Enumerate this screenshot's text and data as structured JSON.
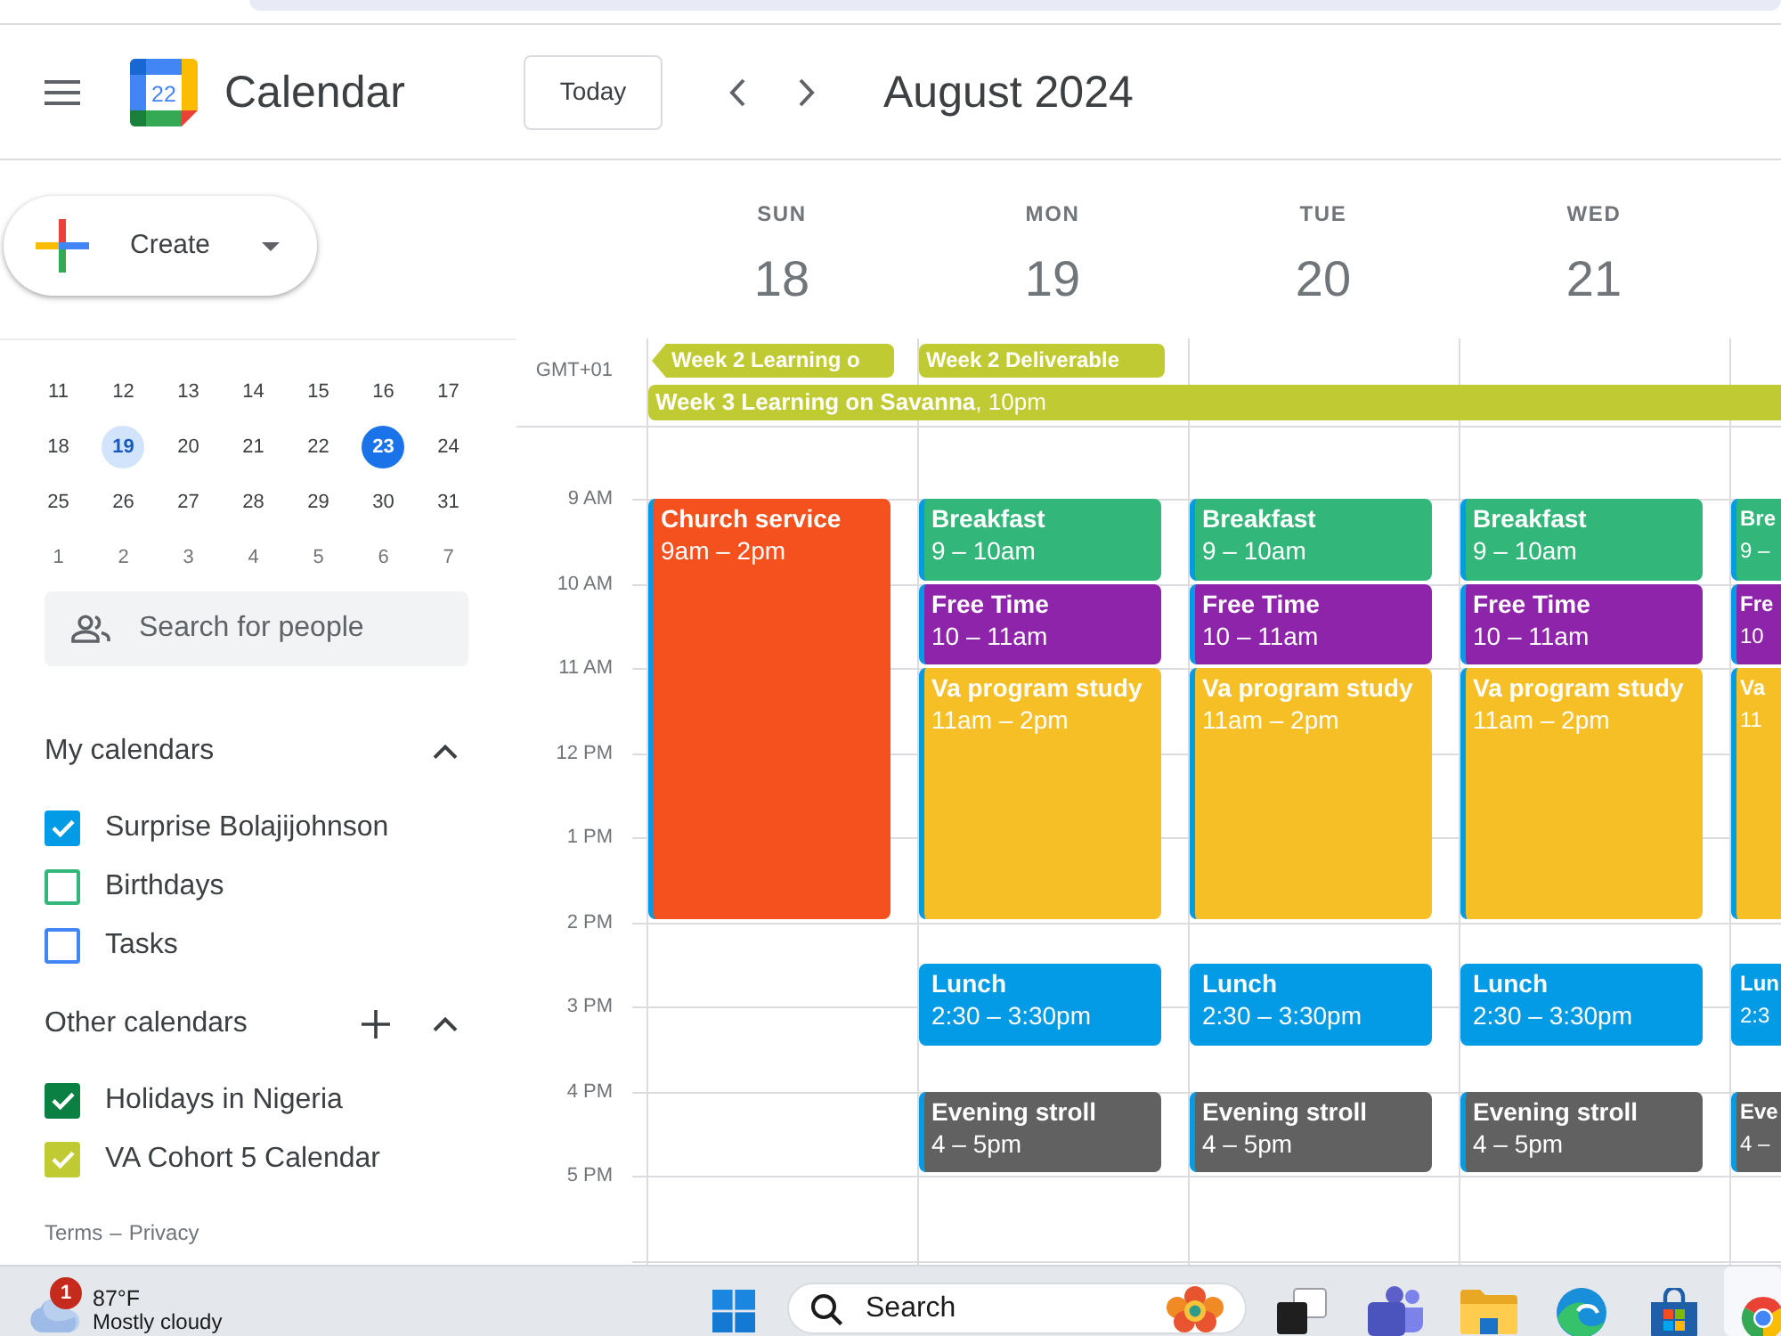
{
  "header": {
    "app_name": "Calendar",
    "logo_day": "22",
    "today_button": "Today",
    "period": "August 2024"
  },
  "create_button": {
    "label": "Create"
  },
  "mini_calendar": {
    "weeks": [
      [
        {
          "day": "11",
          "selected": false,
          "today": false,
          "other_month": false
        },
        {
          "day": "12",
          "selected": false,
          "today": false,
          "other_month": false
        },
        {
          "day": "13",
          "selected": false,
          "today": false,
          "other_month": false
        },
        {
          "day": "14",
          "selected": false,
          "today": false,
          "other_month": false
        },
        {
          "day": "15",
          "selected": false,
          "today": false,
          "other_month": false
        },
        {
          "day": "16",
          "selected": false,
          "today": false,
          "other_month": false
        },
        {
          "day": "17",
          "selected": false,
          "today": false,
          "other_month": false
        }
      ],
      [
        {
          "day": "18",
          "selected": false,
          "today": false,
          "other_month": false
        },
        {
          "day": "19",
          "selected": true,
          "today": false,
          "other_month": false
        },
        {
          "day": "20",
          "selected": false,
          "today": false,
          "other_month": false
        },
        {
          "day": "21",
          "selected": false,
          "today": false,
          "other_month": false
        },
        {
          "day": "22",
          "selected": false,
          "today": false,
          "other_month": false
        },
        {
          "day": "23",
          "selected": false,
          "today": true,
          "other_month": false
        },
        {
          "day": "24",
          "selected": false,
          "today": false,
          "other_month": false
        }
      ],
      [
        {
          "day": "25",
          "selected": false,
          "today": false,
          "other_month": false
        },
        {
          "day": "26",
          "selected": false,
          "today": false,
          "other_month": false
        },
        {
          "day": "27",
          "selected": false,
          "today": false,
          "other_month": false
        },
        {
          "day": "28",
          "selected": false,
          "today": false,
          "other_month": false
        },
        {
          "day": "29",
          "selected": false,
          "today": false,
          "other_month": false
        },
        {
          "day": "30",
          "selected": false,
          "today": false,
          "other_month": false
        },
        {
          "day": "31",
          "selected": false,
          "today": false,
          "other_month": false
        }
      ],
      [
        {
          "day": "1",
          "selected": false,
          "today": false,
          "other_month": true
        },
        {
          "day": "2",
          "selected": false,
          "today": false,
          "other_month": true
        },
        {
          "day": "3",
          "selected": false,
          "today": false,
          "other_month": true
        },
        {
          "day": "4",
          "selected": false,
          "today": false,
          "other_month": true
        },
        {
          "day": "5",
          "selected": false,
          "today": false,
          "other_month": true
        },
        {
          "day": "6",
          "selected": false,
          "today": false,
          "other_month": true
        },
        {
          "day": "7",
          "selected": false,
          "today": false,
          "other_month": true
        }
      ]
    ]
  },
  "people_search": {
    "placeholder": "Search for people"
  },
  "my_calendars": {
    "title": "My calendars",
    "expanded": true,
    "items": [
      {
        "name": "Surprise Bolajijohnson",
        "checked": true,
        "color": "#039be5"
      },
      {
        "name": "Birthdays",
        "checked": false,
        "color": "#33b679"
      },
      {
        "name": "Tasks",
        "checked": false,
        "color": "#4285f4"
      }
    ]
  },
  "other_calendars": {
    "title": "Other calendars",
    "expanded": true,
    "items": [
      {
        "name": "Holidays in Nigeria",
        "checked": true,
        "color": "#0b8043"
      },
      {
        "name": "VA Cohort 5 Calendar",
        "checked": true,
        "color": "#c0ca33"
      }
    ]
  },
  "footer": {
    "links": [
      "Terms",
      "Privacy"
    ],
    "separator": "–"
  },
  "week": {
    "timezone": "GMT+01",
    "hours": [
      "9 AM",
      "10 AM",
      "11 AM",
      "12 PM",
      "1 PM",
      "2 PM",
      "3 PM",
      "4 PM",
      "5 PM"
    ],
    "columns": [
      {
        "weekday": "SUN",
        "date": "18",
        "all_day": [
          {
            "kind": "all_day",
            "title": "Week 2 Learning o",
            "continues_before": true,
            "multi_day": false
          },
          {
            "kind": "timed",
            "title": "**Week 3 Learning on Savanna**, 10pm",
            "continues_before": false,
            "multi_day": true
          }
        ],
        "blocks": [
          {
            "kind": "h5",
            "title": "Church service",
            "time": "9am – 2pm",
            "color": "#f4511e"
          }
        ]
      },
      {
        "weekday": "MON",
        "date": "19",
        "all_day": [
          {
            "kind": "all_day",
            "title": "Week 2 Deliverable",
            "continues_before": false,
            "multi_day": false
          }
        ],
        "blocks": [
          {
            "kind": "h1",
            "title": "Breakfast",
            "time": "9 – 10am",
            "color": "#33b679"
          },
          {
            "kind": "h1",
            "title": "Free Time",
            "time": "10 – 11am",
            "color": "#8e24aa"
          },
          {
            "kind": "h3",
            "title": "Va program study",
            "time": "11am – 2pm",
            "color": "#f6bf26"
          },
          {
            "kind": "gap"
          },
          {
            "kind": "h1",
            "title": "Lunch",
            "time": "2:30 – 3:30pm",
            "color": "#039be5"
          },
          {
            "kind": "gap"
          },
          {
            "kind": "h1",
            "title": "Evening stroll",
            "time": "4 – 5pm",
            "color": "#616161"
          }
        ]
      },
      {
        "weekday": "TUE",
        "date": "20",
        "blocks": [
          {
            "kind": "h1",
            "title": "Breakfast",
            "time": "9 – 10am",
            "color": "#33b679"
          },
          {
            "kind": "h1",
            "title": "Free Time",
            "time": "10 – 11am",
            "color": "#8e24aa"
          },
          {
            "kind": "h3",
            "title": "Va program study",
            "time": "11am – 2pm",
            "color": "#f6bf26"
          },
          {
            "kind": "gap"
          },
          {
            "kind": "h1",
            "title": "Lunch",
            "time": "2:30 – 3:30pm",
            "color": "#039be5"
          },
          {
            "kind": "gap"
          },
          {
            "kind": "h1",
            "title": "Evening stroll",
            "time": "4 – 5pm",
            "color": "#616161"
          }
        ]
      },
      {
        "weekday": "WED",
        "date": "21",
        "blocks": [
          {
            "kind": "h1",
            "title": "Breakfast",
            "time": "9 – 10am",
            "color": "#33b679"
          },
          {
            "kind": "h1",
            "title": "Free Time",
            "time": "10 – 11am",
            "color": "#8e24aa"
          },
          {
            "kind": "h3",
            "title": "Va program study",
            "time": "11am – 2pm",
            "color": "#f6bf26"
          },
          {
            "kind": "gap"
          },
          {
            "kind": "h1",
            "title": "Lunch",
            "time": "2:30 – 3:30pm",
            "color": "#039be5"
          },
          {
            "kind": "gap"
          },
          {
            "kind": "h1",
            "title": "Evening stroll",
            "time": "4 – 5pm",
            "color": "#616161"
          }
        ]
      },
      {
        "blocks": [
          {
            "kind": "h1",
            "title": "Bre",
            "time": "9 –",
            "color": "#33b679"
          },
          {
            "kind": "h1",
            "title": "Fre",
            "time": "10",
            "color": "#8e24aa"
          },
          {
            "kind": "h3",
            "title": "Va",
            "time": "11",
            "color": "#f6bf26"
          },
          {
            "kind": "gap"
          },
          {
            "kind": "h1",
            "title": "Lun",
            "time": "2:3",
            "color": "#039be5"
          },
          {
            "kind": "gap"
          },
          {
            "kind": "h1",
            "title": "Eve",
            "time": "4 –",
            "color": "#616161"
          }
        ]
      }
    ]
  },
  "taskbar": {
    "weather": {
      "badge": "1",
      "temperature": "87°F",
      "condition": "Mostly cloudy"
    },
    "search": {
      "placeholder": "Search"
    }
  }
}
